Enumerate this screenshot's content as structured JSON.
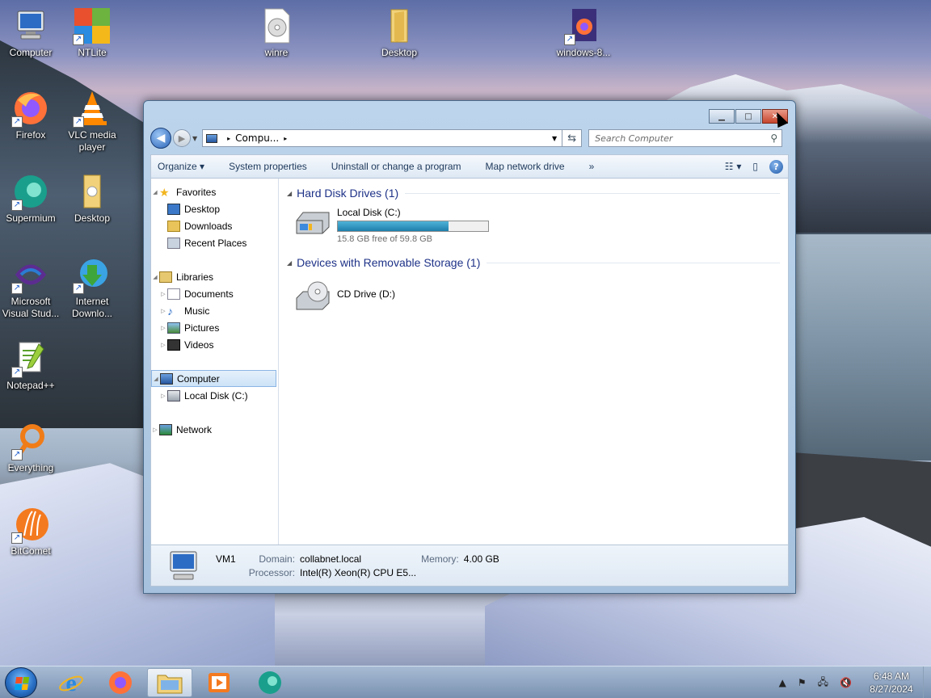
{
  "desktop": {
    "icons": [
      {
        "label": "Computer",
        "shortcut": false
      },
      {
        "label": "NTLite",
        "shortcut": true
      },
      {
        "label": "winre",
        "shortcut": false
      },
      {
        "label": "Desktop",
        "shortcut": false
      },
      {
        "label": "windows-8...",
        "shortcut": true
      },
      {
        "label": "Firefox",
        "shortcut": true
      },
      {
        "label": "VLC media player",
        "shortcut": true
      },
      {
        "label": "Supermium",
        "shortcut": true
      },
      {
        "label": "Desktop",
        "shortcut": false
      },
      {
        "label": "Microsoft Visual Stud...",
        "shortcut": true
      },
      {
        "label": "Internet Downlo...",
        "shortcut": true
      },
      {
        "label": "Notepad++",
        "shortcut": true
      },
      {
        "label": "Everything",
        "shortcut": true
      },
      {
        "label": "BitComet",
        "shortcut": true
      }
    ]
  },
  "explorer": {
    "caption": {
      "minimize": "▁",
      "maximize": "□",
      "close": "✕"
    },
    "nav": {
      "back": "◀",
      "forward": "▶"
    },
    "address": {
      "crumb": "Compu...",
      "separator": "▸"
    },
    "search": {
      "placeholder": "Search Computer"
    },
    "toolbar": {
      "organize": "Organize ▾",
      "system_properties": "System properties",
      "uninstall": "Uninstall or change a program",
      "map_drive": "Map network drive",
      "more": "»",
      "help": "?"
    },
    "navpane": {
      "favorites": "Favorites",
      "fav_desktop": "Desktop",
      "fav_downloads": "Downloads",
      "fav_recent": "Recent Places",
      "libraries": "Libraries",
      "lib_documents": "Documents",
      "lib_music": "Music",
      "lib_pictures": "Pictures",
      "lib_videos": "Videos",
      "computer": "Computer",
      "local_disk": "Local Disk (C:)",
      "network": "Network"
    },
    "content": {
      "hdd_group": "Hard Disk Drives (1)",
      "local_disk_name": "Local Disk (C:)",
      "local_disk_used_fraction": 0.736,
      "local_disk_free": "15.8 GB free of 59.8 GB",
      "removable_group": "Devices with Removable Storage (1)",
      "cd_drive_name": "CD Drive (D:)"
    },
    "details": {
      "name": "VM1",
      "domain_label": "Domain:",
      "domain_value": "collabnet.local",
      "memory_label": "Memory:",
      "memory_value": "4.00 GB",
      "processor_label": "Processor:",
      "processor_value": "Intel(R) Xeon(R) CPU E5..."
    }
  },
  "taskbar": {
    "apps": [
      "internet-explorer",
      "firefox",
      "file-explorer",
      "media-player",
      "supermium"
    ],
    "clock_time": "6:48 AM",
    "clock_date": "8/27/2024"
  },
  "colors": {
    "accent": "#1e3287",
    "progress": "#1e7fab",
    "selection": "#cde3f8"
  }
}
